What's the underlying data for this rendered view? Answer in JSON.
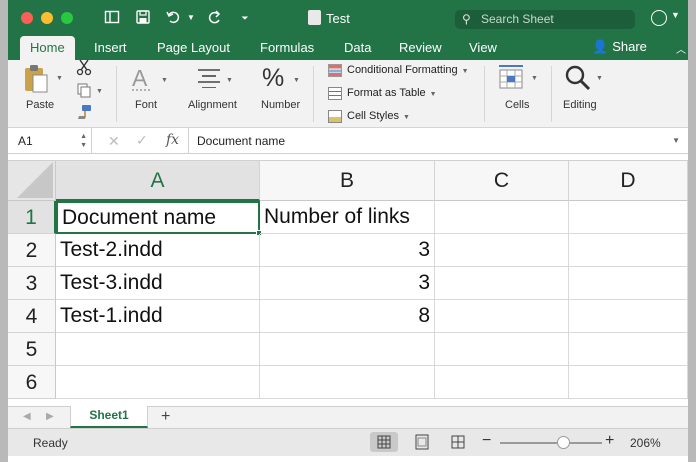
{
  "window": {
    "title": "Test",
    "search_placeholder": "Search Sheet"
  },
  "tabs": [
    {
      "label": "Home",
      "active": true
    },
    {
      "label": "Insert"
    },
    {
      "label": "Page Layout"
    },
    {
      "label": "Formulas"
    },
    {
      "label": "Data"
    },
    {
      "label": "Review"
    },
    {
      "label": "View"
    }
  ],
  "share_label": "Share",
  "ribbon": {
    "paste": "Paste",
    "font": "Font",
    "alignment": "Alignment",
    "number": "Number",
    "conditional_formatting": "Conditional Formatting",
    "format_as_table": "Format as Table",
    "cell_styles": "Cell Styles",
    "cells": "Cells",
    "editing": "Editing"
  },
  "formula_bar": {
    "name_box": "A1",
    "fx": "fx",
    "value": "Document name"
  },
  "grid": {
    "columns": [
      "A",
      "B",
      "C",
      "D"
    ],
    "selected_column": "A",
    "rows": [
      "1",
      "2",
      "3",
      "4",
      "5",
      "6"
    ],
    "selected_row": "1",
    "cells": [
      [
        "Document name",
        "Number of links",
        "",
        ""
      ],
      [
        "Test-2.indd",
        "3",
        "",
        ""
      ],
      [
        "Test-3.indd",
        "3",
        "",
        ""
      ],
      [
        "Test-1.indd",
        "8",
        "",
        ""
      ],
      [
        "",
        "",
        "",
        ""
      ],
      [
        "",
        "",
        "",
        ""
      ]
    ]
  },
  "sheets": [
    {
      "label": "Sheet1",
      "active": true
    }
  ],
  "status": {
    "text": "Ready",
    "zoom": "206%",
    "zoom_level": 0.62
  },
  "colors": {
    "accent": "#227447"
  }
}
